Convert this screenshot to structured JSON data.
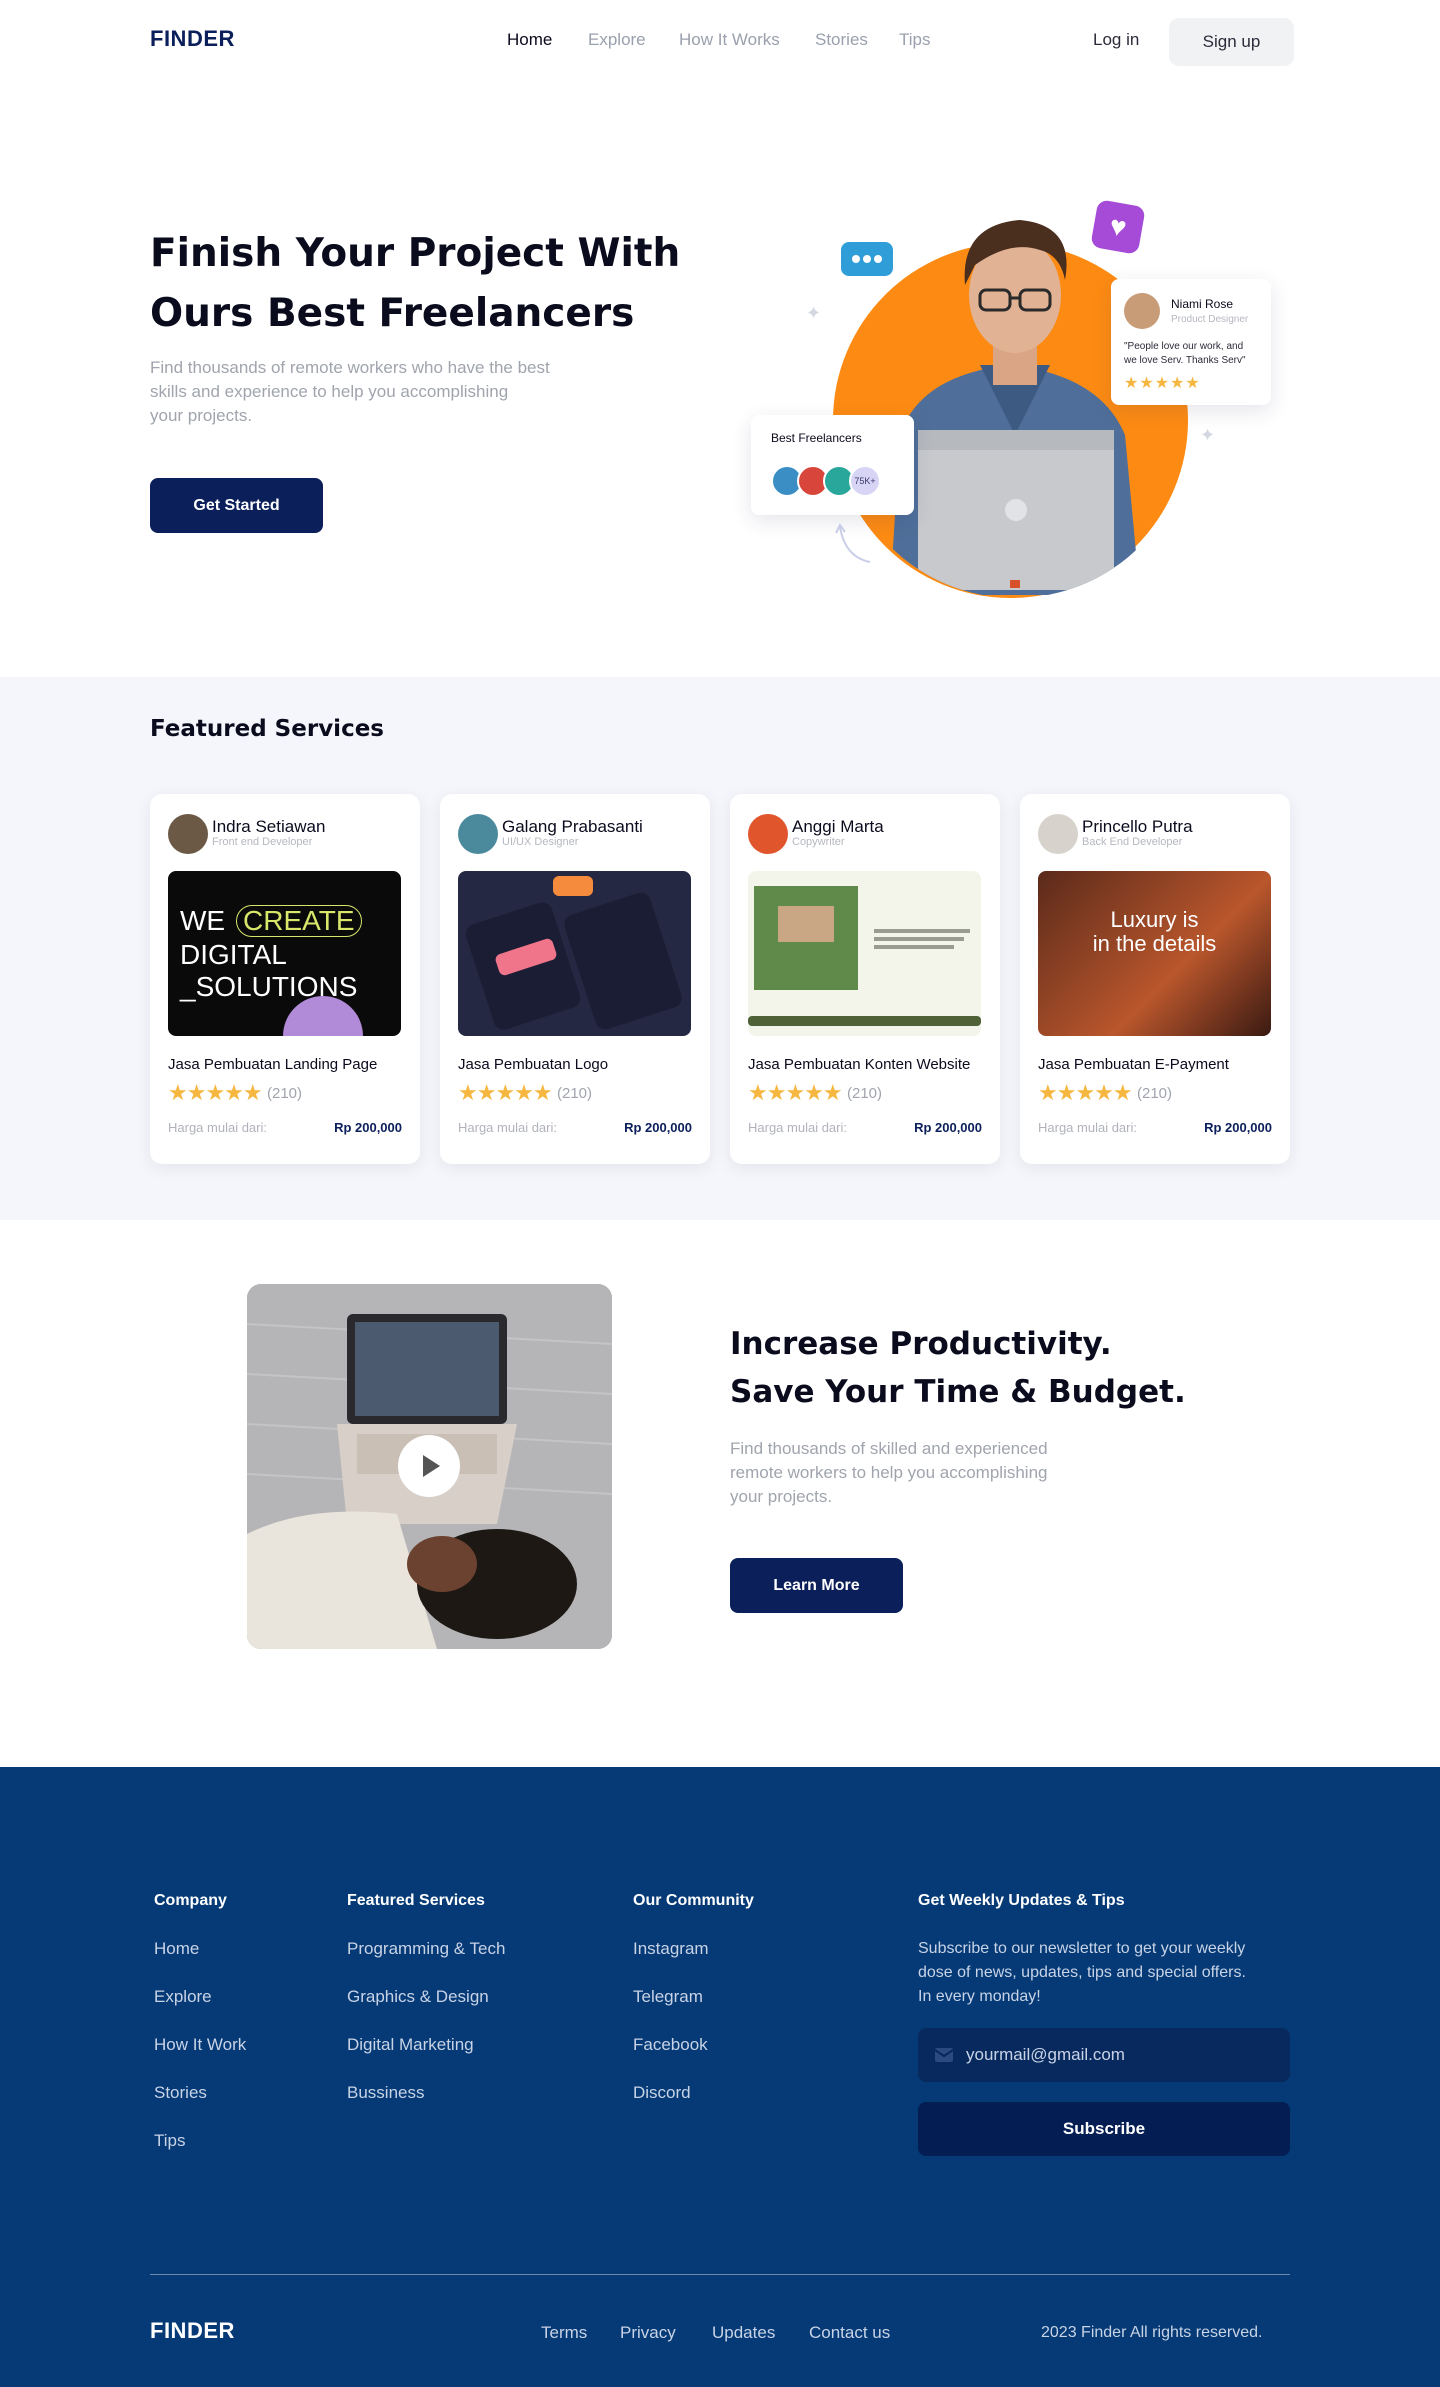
{
  "nav": {
    "logo": "FINDER",
    "links": [
      "Home",
      "Explore",
      "How It Works",
      "Stories",
      "Tips"
    ],
    "login": "Log in",
    "signup": "Sign up"
  },
  "hero": {
    "title_line1": "Finish Your Project With",
    "title_line2": "Ours Best Freelancers",
    "subtitle_line1": "Find thousands of remote workers who have the best",
    "subtitle_line2": "skills and experience to help you accomplishing",
    "subtitle_line3": "your projects.",
    "cta": "Get Started",
    "testimonial": {
      "name": "Niami Rose",
      "role": "Product Designer",
      "quote_line1": "\"People love our work, and",
      "quote_line2": "we love Serv. Thanks Serv\"",
      "stars": "★★★★★"
    },
    "best": {
      "label": "Best Freelancers",
      "count": "75K+"
    }
  },
  "featured": {
    "title": "Featured  Services",
    "cards": [
      {
        "name": "Indra Setiawan",
        "role": "Front end Developer",
        "title": "Jasa Pembuatan Landing Page",
        "stars": "★★★★★",
        "count": "(210)",
        "price_label": "Harga mulai dari:",
        "price": "Rp 200,000",
        "thumb_text1": "WE",
        "thumb_text2": "CREATE",
        "thumb_text3": "DIGITAL",
        "thumb_text4": "_SOLUTIONS"
      },
      {
        "name": "Galang Prabasanti",
        "role": "UI/UX Designer",
        "title": "Jasa Pembuatan Logo",
        "stars": "★★★★★",
        "count": "(210)",
        "price_label": "Harga mulai dari:",
        "price": "Rp 200,000"
      },
      {
        "name": "Anggi Marta",
        "role": "Copywriter",
        "title": "Jasa Pembuatan Konten Website",
        "stars": "★★★★★",
        "count": "(210)",
        "price_label": "Harga mulai dari:",
        "price": "Rp 200,000"
      },
      {
        "name": "Princello Putra",
        "role": "Back End Developer",
        "title": "Jasa Pembuatan E-Payment",
        "stars": "★★★★★",
        "count": "(210)",
        "price_label": "Harga mulai dari:",
        "price": "Rp 200,000",
        "thumb_text1": "Luxury is",
        "thumb_text2": "in the details"
      }
    ]
  },
  "productivity": {
    "title_line1": "Increase Productivity.",
    "title_line2": "Save Your Time  & Budget.",
    "subtitle_line1": "Find thousands of skilled and experienced",
    "subtitle_line2": "remote workers to help you accomplishing",
    "subtitle_line3": "your projects.",
    "cta": "Learn More"
  },
  "footer": {
    "company": {
      "heading": "Company",
      "links": [
        "Home",
        "Explore",
        "How It Work",
        "Stories",
        "Tips"
      ]
    },
    "services": {
      "heading": "Featured Services",
      "links": [
        "Programming & Tech",
        "Graphics & Design",
        "Digital Marketing",
        "Bussiness"
      ]
    },
    "community": {
      "heading": "Our Community",
      "links": [
        "Instagram",
        "Telegram",
        "Facebook",
        "Discord"
      ]
    },
    "newsletter": {
      "heading": "Get Weekly  Updates & Tips",
      "text_line1": "Subscribe to our  newsletter to get your weekly",
      "text_line2": "dose of news, updates, tips and special offers.",
      "text_line3": "In every monday!",
      "email": "yourmail@gmail.com",
      "button": "Subscribe"
    },
    "logo": "FINDER",
    "bottom_links": [
      "Terms",
      "Privacy",
      "Updates",
      "Contact us"
    ],
    "copyright": "2023 Finder All rights  reserved."
  },
  "colors": {
    "brand_navy": "#0b1f5a",
    "accent_orange": "#fd8b13",
    "footer_blue": "#053a76",
    "star_yellow": "#f5b740"
  }
}
